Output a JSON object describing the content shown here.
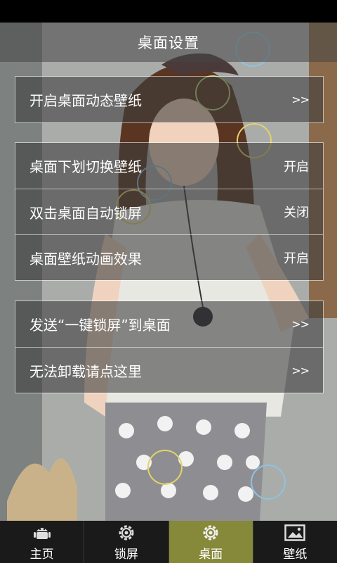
{
  "header": {
    "title": "桌面设置"
  },
  "groups": [
    {
      "rows": [
        {
          "label": "开启桌面动态壁纸",
          "value": ">>"
        }
      ]
    },
    {
      "rows": [
        {
          "label": "桌面下划切换壁纸",
          "value": "开启"
        },
        {
          "label": "双击桌面自动锁屏",
          "value": "关闭"
        },
        {
          "label": "桌面壁纸动画效果",
          "value": "开启"
        }
      ]
    },
    {
      "rows": [
        {
          "label": "发送“一键锁屏”到桌面",
          "value": ">>"
        },
        {
          "label": "无法卸载请点这里",
          "value": ">>"
        }
      ]
    }
  ],
  "nav": {
    "items": [
      {
        "label": "主页",
        "icon": "android-icon"
      },
      {
        "label": "锁屏",
        "icon": "gear-icon"
      },
      {
        "label": "桌面",
        "icon": "gear-icon",
        "active": true
      },
      {
        "label": "壁纸",
        "icon": "image-icon"
      }
    ]
  },
  "colors": {
    "active_tab": "#86883a",
    "nav_bg": "#1a1a1a",
    "header_bg": "#464646"
  }
}
